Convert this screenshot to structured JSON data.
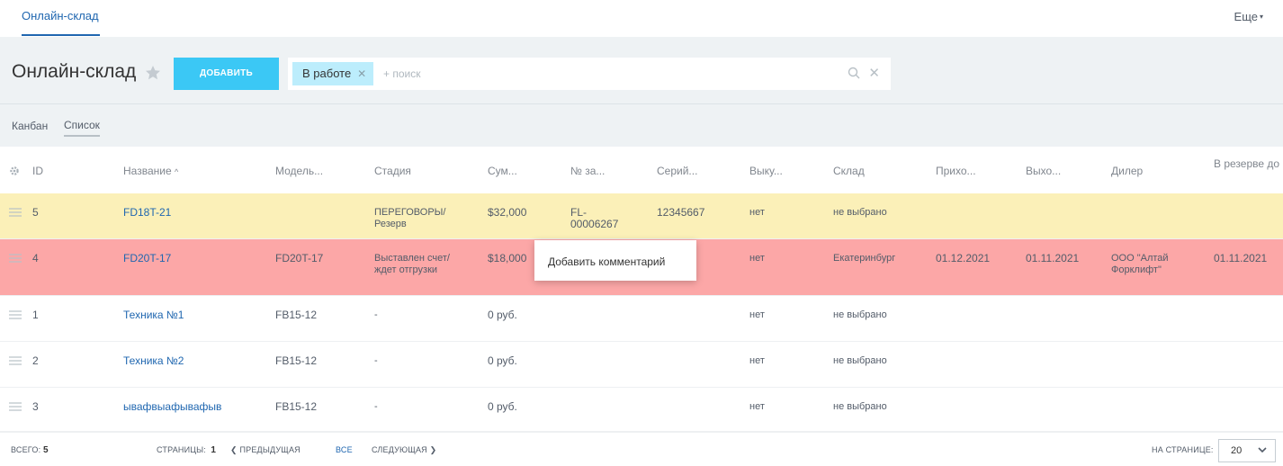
{
  "topnav": {
    "tab": "Онлайн-склад",
    "more": "Еще"
  },
  "header": {
    "title": "Онлайн-склад",
    "add_label": "ДОБАВИТЬ",
    "filter_chip": "В работе",
    "search_placeholder": "+ поиск"
  },
  "views": {
    "kanban": "Канбан",
    "list": "Список"
  },
  "columns": {
    "id": "ID",
    "name": "Название",
    "model": "Модель...",
    "stage": "Стадия",
    "sum": "Сум...",
    "order_no": "№ за...",
    "serial": "Серий...",
    "buyout": "Выку...",
    "warehouse": "Склад",
    "arrival": "Прихо...",
    "exit": "Выхо...",
    "dealer": "Дилер",
    "reserve_until": "В резерве до"
  },
  "rows": [
    {
      "id": "5",
      "name": "FD18T-21",
      "model": "",
      "stage": "ПЕРЕГОВОРЫ/ Резерв",
      "sum": "$32,000",
      "order_no": "FL- 00006267",
      "serial": "12345667",
      "buyout": "нет",
      "warehouse": "не выбрано",
      "arrival": "",
      "exit": "",
      "dealer": "",
      "reserve_until": ""
    },
    {
      "id": "4",
      "name": "FD20T-17",
      "model": "FD20T-17",
      "stage": "Выставлен счет/ждет отгрузки",
      "sum": "$18,000",
      "order_no": "",
      "serial": "",
      "buyout": "нет",
      "warehouse": "Екатеринбург",
      "arrival": "01.12.2021",
      "exit": "01.11.2021",
      "dealer": "ООО \"Алтай Форклифт\"",
      "reserve_until": "01.11.2021"
    },
    {
      "id": "1",
      "name": "Техника №1",
      "model": "FB15-12",
      "stage": "-",
      "sum": "0 руб.",
      "order_no": "",
      "serial": "",
      "buyout": "нет",
      "warehouse": "не выбрано",
      "arrival": "",
      "exit": "",
      "dealer": "",
      "reserve_until": ""
    },
    {
      "id": "2",
      "name": "Техника №2",
      "model": "FB15-12",
      "stage": "-",
      "sum": "0 руб.",
      "order_no": "",
      "serial": "",
      "buyout": "нет",
      "warehouse": "не выбрано",
      "arrival": "",
      "exit": "",
      "dealer": "",
      "reserve_until": ""
    },
    {
      "id": "3",
      "name": "ывафвыафывафыв",
      "model": "FB15-12",
      "stage": "-",
      "sum": "0 руб.",
      "order_no": "",
      "serial": "",
      "buyout": "нет",
      "warehouse": "не выбрано",
      "arrival": "",
      "exit": "",
      "dealer": "",
      "reserve_until": ""
    }
  ],
  "context_menu": {
    "item": "Добавить комментарий"
  },
  "footer": {
    "total_label": "ВСЕГО:",
    "total_value": "5",
    "pages_label": "СТРАНИЦЫ:",
    "pages_value": "1",
    "prev": "ПРЕДЫДУЩАЯ",
    "all": "ВСЕ",
    "next": "СЛЕДУЮЩАЯ",
    "per_page_label": "НА СТРАНИЦЕ:",
    "per_page_value": "20"
  },
  "colors": {
    "accent": "#3bc8f5",
    "link": "#2067b0",
    "row_yellow": "#fbf0b8",
    "row_red": "#fca7a7",
    "chip": "#bcedfc"
  }
}
